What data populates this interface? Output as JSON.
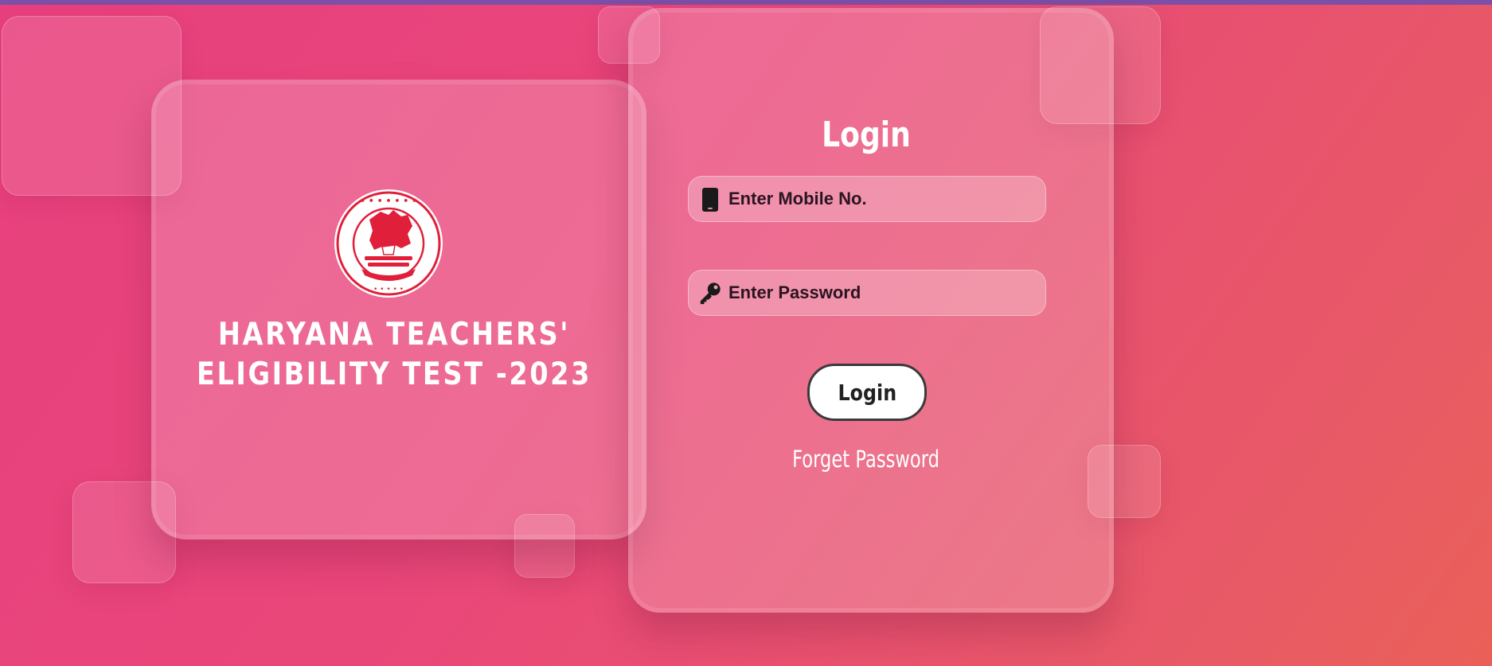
{
  "brand": {
    "title": "HARYANA TEACHERS'\nELIGIBILITY TEST -2023",
    "logo_icon": "haryana-school-education-board-seal"
  },
  "login": {
    "title": "Login",
    "mobile_placeholder": "Enter Mobile No.",
    "mobile_icon": "mobile-phone-icon",
    "password_placeholder": "Enter Password",
    "password_icon": "key-icon",
    "submit_label": "Login",
    "forget_label": "Forget Password"
  },
  "colors": {
    "background_start": "#e8407e",
    "background_end": "#ea6058",
    "top_bar": "#7c4fa8",
    "seal_red": "#e0203a",
    "text_white": "#ffffff",
    "button_bg": "#ffffff"
  }
}
